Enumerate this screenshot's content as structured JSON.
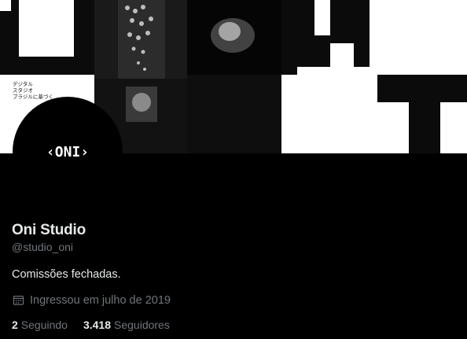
{
  "banner": {
    "japanese_caption": [
      "デジタル",
      "スタジオ",
      "ブラジルに基づく"
    ]
  },
  "avatar": {
    "logo_text": "‹ONI›"
  },
  "profile": {
    "name": "Oni Studio",
    "handle": "@studio_oni",
    "bio": "Comissões fechadas.",
    "joined_icon": "calendar-icon",
    "joined": "Ingressou em julho de 2019",
    "following_count": "2",
    "following_label": "Seguindo",
    "followers_count": "3.418",
    "followers_label": "Seguidores"
  },
  "colors": {
    "background": "#000000",
    "primary_text": "#e7e9ea",
    "secondary_text": "#71767b"
  }
}
